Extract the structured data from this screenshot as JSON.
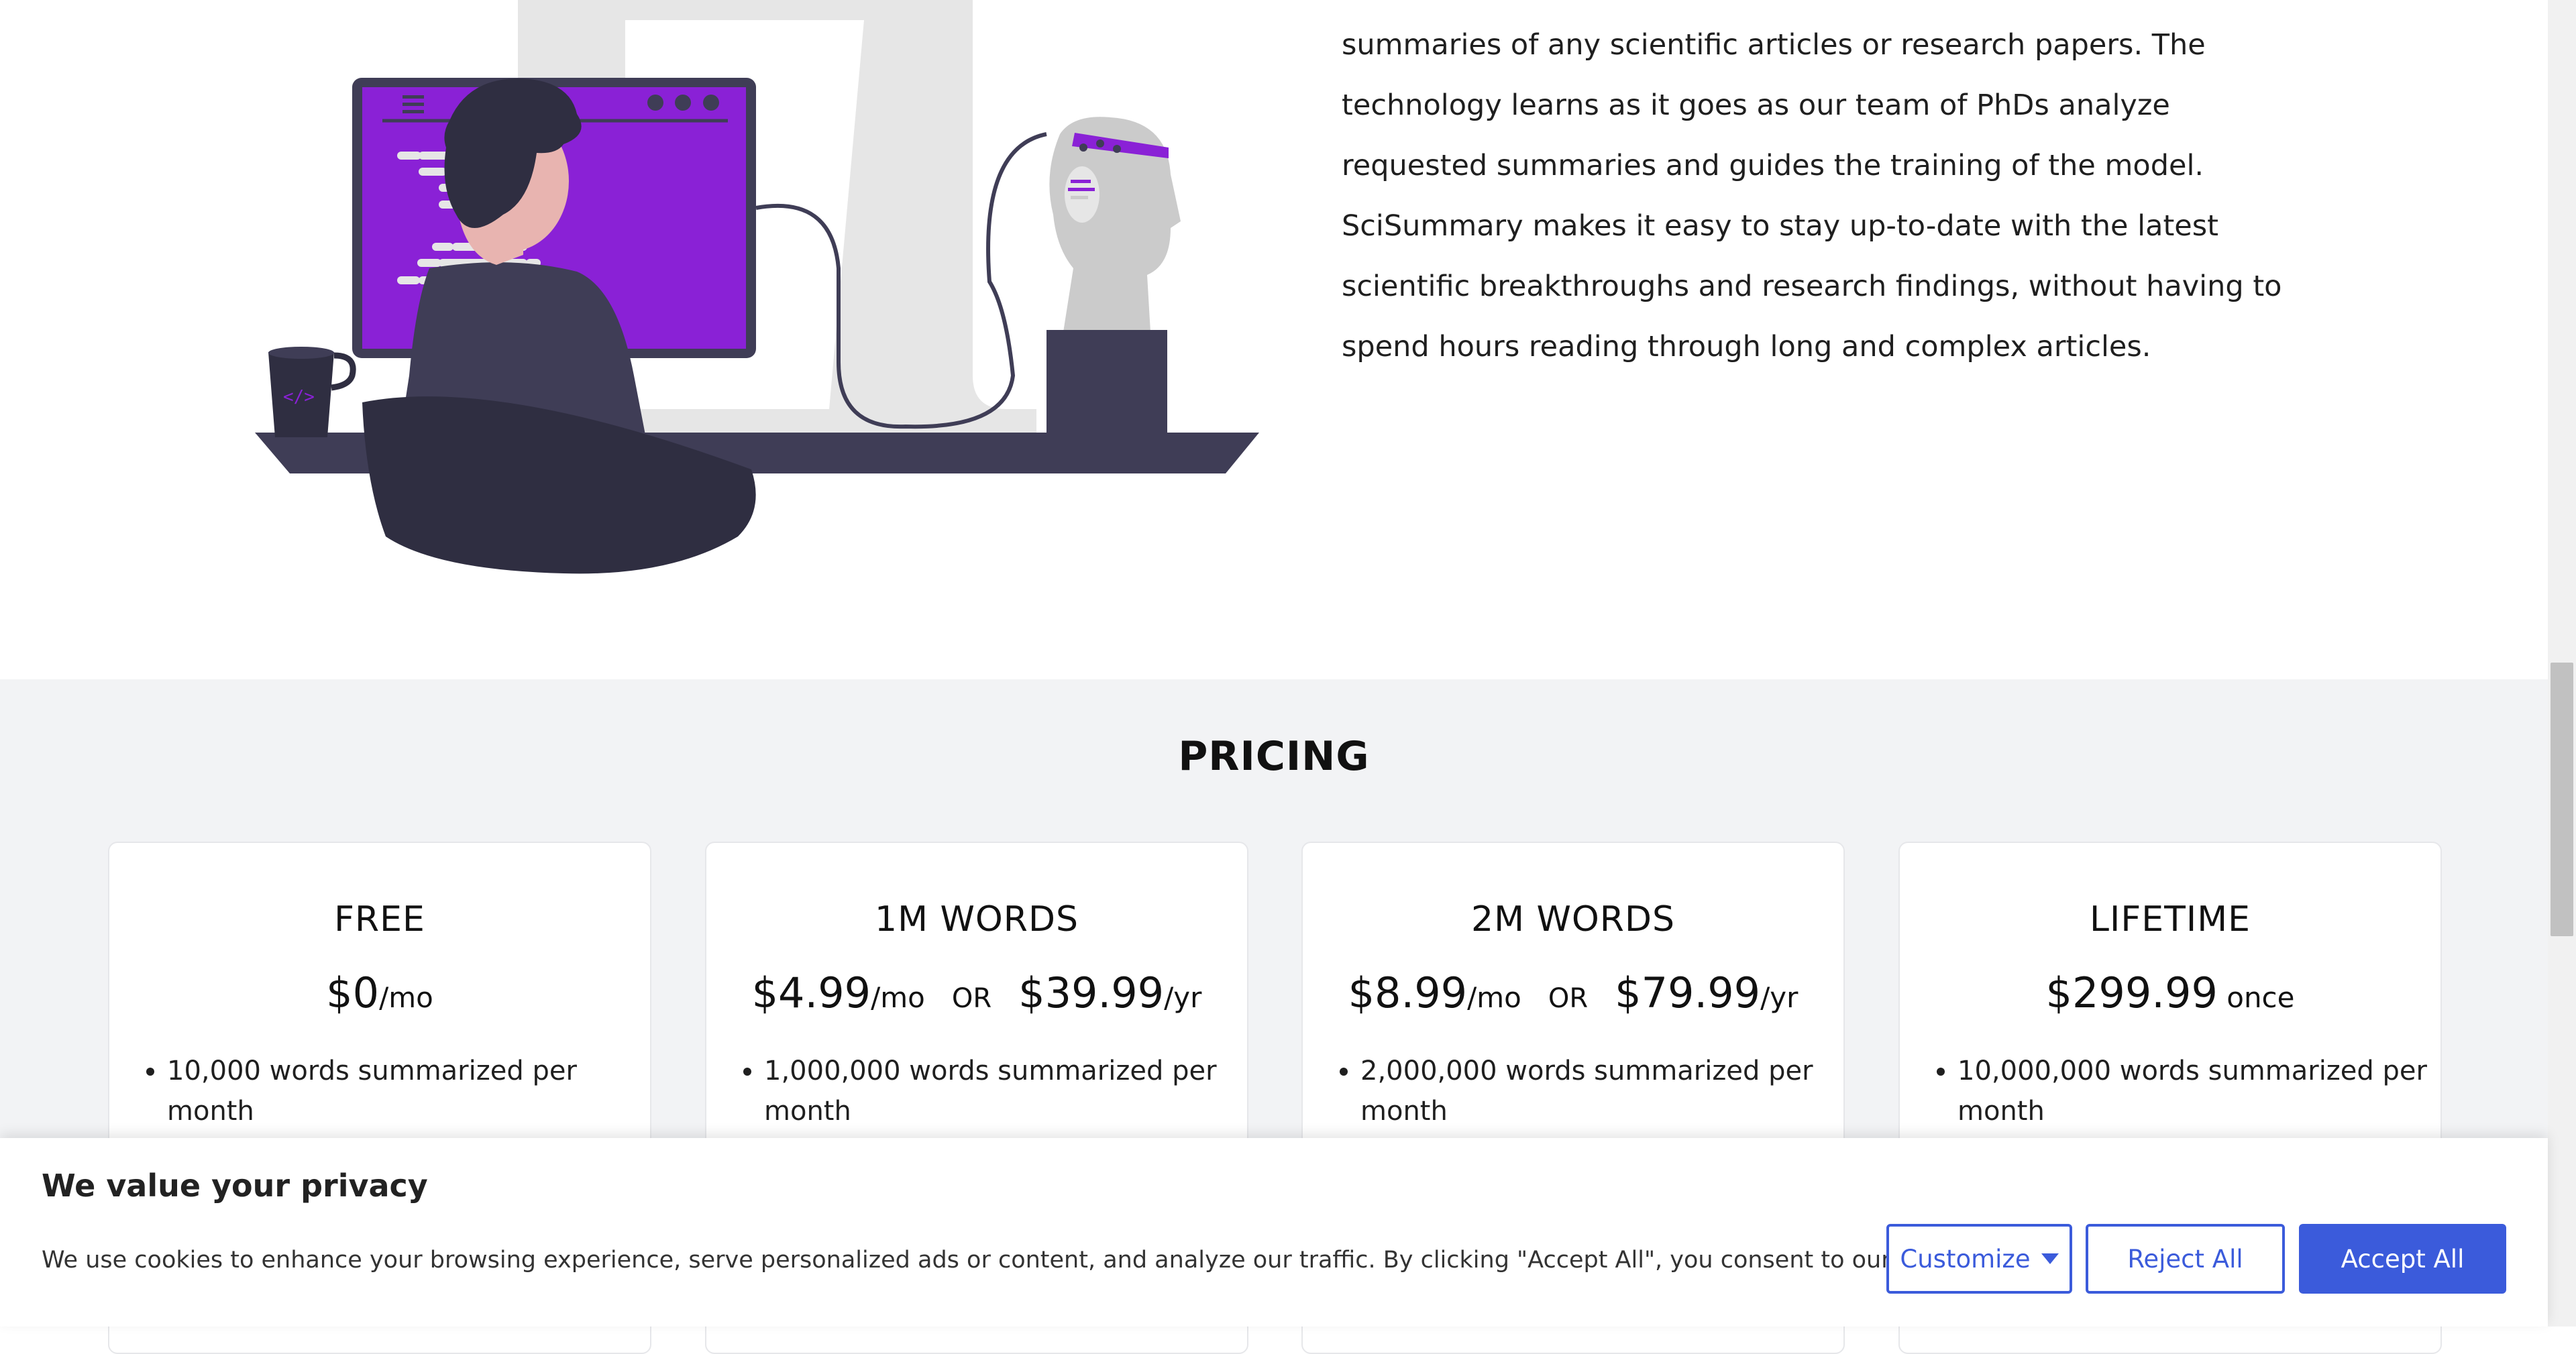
{
  "about": {
    "lines": [
      "summaries of any scientific articles or research papers. The",
      "technology learns as it goes as our team of PhDs analyze",
      "requested summaries and guides the training of the model.",
      "SciSummary makes it easy to stay up-to-date with the latest",
      "scientific breakthroughs and research findings, without having to",
      "spend hours reading through long and complex articles."
    ]
  },
  "illustration": {
    "icon": "person-at-computer-with-robot-head-illustration"
  },
  "pricing": {
    "title": "PRICING",
    "or_label": "OR",
    "plans": [
      {
        "name": "FREE",
        "price": "$0",
        "unit": "/mo",
        "feature": "10,000 words summarized per month"
      },
      {
        "name": "1M WORDS",
        "price": "$4.99",
        "unit": "/mo",
        "alt_price": "$39.99",
        "alt_unit": "/yr",
        "feature": "1,000,000 words summarized per month"
      },
      {
        "name": "2M WORDS",
        "price": "$8.99",
        "unit": "/mo",
        "alt_price": "$79.99",
        "alt_unit": "/yr",
        "feature": "2,000,000 words summarized per month"
      },
      {
        "name": "LIFETIME",
        "price": "$299.99",
        "unit": " once",
        "feature": "10,000,000 words summarized per month"
      }
    ]
  },
  "cookie_banner": {
    "title": "We value your privacy",
    "text": "We use cookies to enhance your browsing experience, serve personalized ads or content, and analyze our traffic. By clicking \"Accept All\", you consent to our use of cookies.",
    "customize_label": "Customize",
    "reject_label": "Reject All",
    "accept_label": "Accept All"
  },
  "colors": {
    "accent": "#3b5bdb",
    "illustration_purple": "#8a21d6",
    "illustration_dark": "#3f3d56",
    "pricing_bg": "#f2f3f5"
  }
}
